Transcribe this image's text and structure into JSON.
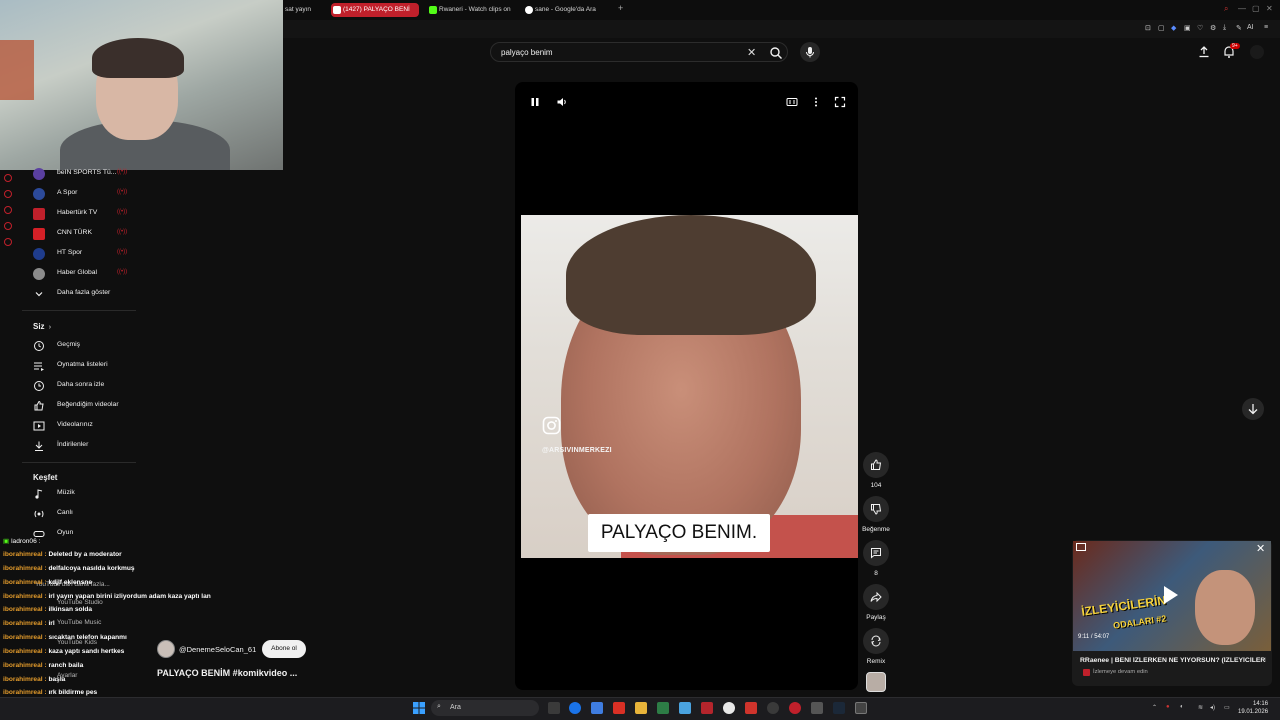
{
  "browser": {
    "tabs": [
      {
        "label": "sat yayın",
        "active": false
      },
      {
        "label": "(1427) PALYAÇO BENİ",
        "active": true
      },
      {
        "label": "Rwaneri - Watch clips on",
        "active": false
      },
      {
        "label": "sane - Google'da Ara",
        "active": false
      }
    ],
    "new_tab": "+",
    "toolbar_ai_label": "AI"
  },
  "search": {
    "query": "palyaço benim",
    "clear": "✕"
  },
  "notifications": {
    "badge": "9+"
  },
  "sidebar": {
    "channels": [
      {
        "label": "beIN SPORTS Tü...",
        "color": "#5a3fa0",
        "logo": "B"
      },
      {
        "label": "A Spor",
        "color": "#2c4a9a",
        "logo": "A"
      },
      {
        "label": "Habertürk TV",
        "color": "#c0202b",
        "logo": "H"
      },
      {
        "label": "CNN TÜRK",
        "color": "#d42027",
        "logo": "C"
      },
      {
        "label": "HT Spor",
        "color": "#1f3c8c",
        "logo": "HT"
      },
      {
        "label": "Haber Global",
        "color": "#8b8b8b",
        "logo": "HG"
      }
    ],
    "show_more": "Daha fazla göster",
    "you_section": "Siz",
    "you_items": [
      {
        "label": "Geçmiş",
        "icon": "history-icon"
      },
      {
        "label": "Oynatma listeleri",
        "icon": "playlist-icon"
      },
      {
        "label": "Daha sonra izle",
        "icon": "clock-icon"
      },
      {
        "label": "Beğendiğim videolar",
        "icon": "like-icon"
      },
      {
        "label": "Videolarınız",
        "icon": "video-icon"
      },
      {
        "label": "İndirilenler",
        "icon": "download-icon"
      }
    ],
    "explore_section": "Keşfet",
    "explore_items": [
      {
        "label": "Müzik",
        "icon": "music-icon"
      },
      {
        "label": "Canlı",
        "icon": "live-icon"
      },
      {
        "label": "Oyun",
        "icon": "game-icon"
      }
    ],
    "hidden_items": [
      "YouTube'dan daha fazla...",
      "YouTube Studio",
      "YouTube Music",
      "YouTube Kids",
      "Ayarlar"
    ]
  },
  "chat": {
    "header": "ladron06 :",
    "lines": [
      {
        "user": "iborahimreal :",
        "msg": "Deleted by a moderator"
      },
      {
        "user": "iborahimreal :",
        "msg": "delfalcoya nasılda korkmuş"
      },
      {
        "user": "iborahimreal :",
        "msg": "kdjlf eklensne"
      },
      {
        "user": "iborahimreal :",
        "msg": "irl yayın yapan birini izliyordum adam kaza yaptı lan"
      },
      {
        "user": "iborahimreal :",
        "msg": "ilkinsan solda"
      },
      {
        "user": "iborahimreal :",
        "msg": "irl"
      },
      {
        "user": "iborahimreal :",
        "msg": "sıcaktan telefon kapanmı"
      },
      {
        "user": "iborahimreal :",
        "msg": "kaza yaptı sandı hertkes"
      },
      {
        "user": "iborahimreal :",
        "msg": "ranch baila"
      },
      {
        "user": "iborahimreal :",
        "msg": "başla"
      },
      {
        "user": "iborahimreal :",
        "msg": "ırk bildirme pes"
      }
    ]
  },
  "short": {
    "watermark_handle": "@ARSIVINMERKEZI",
    "caption": "PALYAÇO BENIM.",
    "channel": "@DenemeSeloCan_61",
    "subscribe_label": "Abone ol",
    "title": "PALYAÇO BENİM #komikvideo ..."
  },
  "actions": {
    "like_count": "104",
    "dislike_label": "Beğenme",
    "comment_count": "8",
    "share_label": "Paylaş",
    "remix_label": "Remix"
  },
  "mini_player": {
    "time": "9:11 / 54:07",
    "thumb_text_1": "İZLEYİCİLERİN",
    "thumb_text_2": "ODALARI #2",
    "title": "RRaenee | BENİ İZLERKEN NE YİYORSUN? (İZLEYİCİLERİ...",
    "subtitle": "İzlemeye devam edin"
  },
  "taskbar": {
    "search_placeholder": "Ara",
    "time": "14:16",
    "date": "19.01.2026"
  },
  "colors": {
    "accent_red": "#c0202b",
    "background": "#0f0f0f",
    "chat_user": "#e39b2b"
  }
}
